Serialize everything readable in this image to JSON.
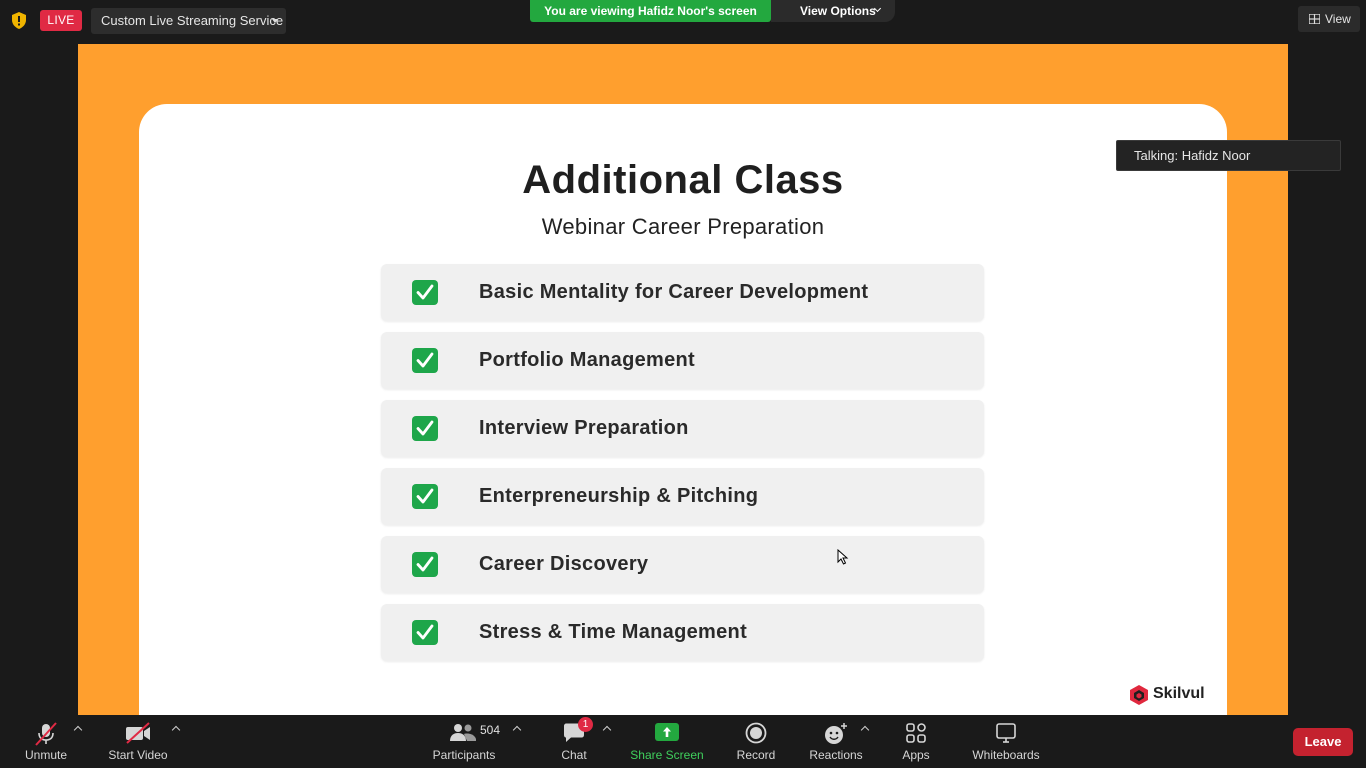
{
  "top_bar": {
    "live_label": "LIVE",
    "stream_service": "Custom Live Streaming Service",
    "viewing_banner": "You are viewing Hafidz Noor's screen",
    "view_options": "View Options",
    "view_label": "View"
  },
  "slide": {
    "title": "Additional Class",
    "subtitle": "Webinar Career Preparation",
    "topics": [
      "Basic Mentality for Career Development",
      "Portfolio Management",
      "Interview Preparation",
      "Enterpreneurship & Pitching",
      "Career Discovery",
      "Stress & Time Management"
    ],
    "brand_name": "Skilvul",
    "colors": {
      "background": "#ff9f2e",
      "card": "#ffffff",
      "check": "#1ea64a"
    }
  },
  "talking_indicator": "Talking: Hafidz Noor",
  "toolbar": {
    "unmute": "Unmute",
    "start_video": "Start Video",
    "participants": "Participants",
    "participants_count": "504",
    "chat": "Chat",
    "chat_badge": "1",
    "share_screen": "Share Screen",
    "record": "Record",
    "reactions": "Reactions",
    "apps": "Apps",
    "whiteboards": "Whiteboards",
    "leave": "Leave"
  },
  "icons": {
    "shield": "shield-icon",
    "mic_muted": "mic-muted-icon",
    "video_off": "video-off-icon",
    "participants": "participants-icon",
    "chat": "chat-icon",
    "share": "share-screen-icon",
    "record": "record-icon",
    "reactions": "reactions-icon",
    "apps": "apps-icon",
    "whiteboard": "whiteboard-icon"
  },
  "accent_colors": {
    "live": "#e02a44",
    "banner": "#23a83f",
    "leave": "#c4222f",
    "share": "#23a83f"
  }
}
